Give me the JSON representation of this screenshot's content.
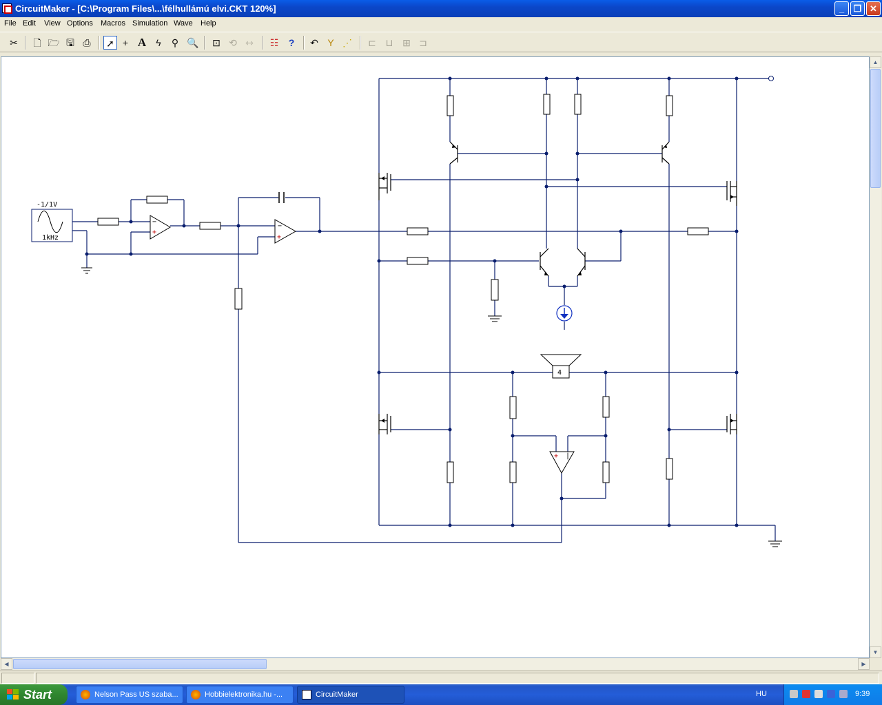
{
  "window": {
    "title": "CircuitMaker - [C:\\Program Files\\...\\félhullámú elvi.CKT 120%]",
    "minimize_glyph": "_",
    "maximize_glyph": "❐",
    "close_glyph": "✕"
  },
  "menu": {
    "items": [
      "File",
      "Edit",
      "View",
      "Options",
      "Macros",
      "Simulation",
      "Wave",
      "Help"
    ]
  },
  "toolbar": {
    "icons": [
      "cut-icon",
      "new-file-icon",
      "open-folder-icon",
      "save-icon",
      "print-icon",
      "arrow-tool-icon",
      "wire-tool-icon",
      "text-tool-icon",
      "probe-tool-icon",
      "zoom-tool-icon",
      "magnifier-icon",
      "fit-icon",
      "rotate-icon",
      "mirror-icon",
      "digital-sim-icon",
      "help-icon",
      "undo-icon",
      "macro-icon",
      "analog-icon",
      "align-icon"
    ]
  },
  "schematic": {
    "signal_source": {
      "amplitude_label": "-1/1V",
      "frequency_label": "1kHz"
    },
    "speaker_label": "4",
    "wire_color": "#0a1e6e",
    "component_color": "#000000",
    "opamp_plus_color": "#c00000",
    "current_source_color": "#1030c0"
  },
  "taskbar": {
    "start_label": "Start",
    "tasks": [
      "Nelson Pass US szaba...",
      "Hobbielektronika.hu -...",
      "CircuitMaker"
    ],
    "language": "HU",
    "clock": "9:39"
  }
}
